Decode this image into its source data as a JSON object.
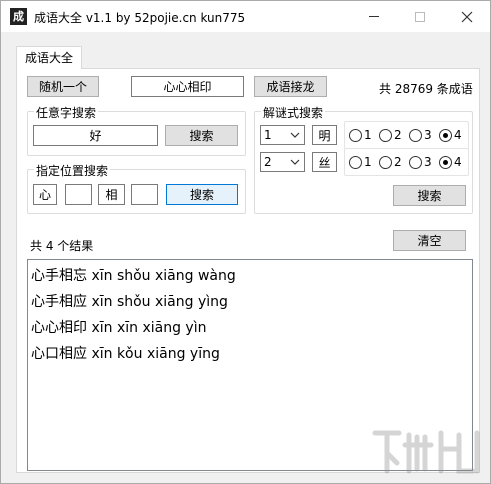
{
  "window": {
    "title": "成语大全 v1.1 by 52pojie.cn kun775",
    "icon_glyph": "成"
  },
  "tab": {
    "label": "成语大全"
  },
  "top": {
    "random_button": "随机一个",
    "current_idiom": "心心相印",
    "chain_button": "成语接龙",
    "total_text": "共 28769 条成语"
  },
  "any_search": {
    "title": "任意字搜索",
    "value": "好",
    "button": "搜索"
  },
  "position_search": {
    "title": "指定位置搜索",
    "chars": [
      "心",
      "",
      "相",
      ""
    ],
    "button": "搜索"
  },
  "riddle_search": {
    "title": "解谜式搜索",
    "rows": [
      {
        "select": "1",
        "char": "明",
        "options": [
          "1",
          "2",
          "3",
          "4"
        ],
        "selected": 3
      },
      {
        "select": "2",
        "char": "丝",
        "options": [
          "1",
          "2",
          "3",
          "4"
        ],
        "selected": 3
      }
    ],
    "button": "搜索"
  },
  "results": {
    "count_text": "共 4 个结果",
    "clear_button": "清空",
    "items": [
      "心手相忘 xīn shǒu xiāng wàng",
      "心手相应 xīn shǒu xiāng yìng",
      "心心相印 xīn xīn xiāng yìn",
      "心口相应 xīn kǒu xiāng yīng"
    ]
  },
  "icons": {
    "app": "app-icon",
    "minimize": "minimize-icon",
    "maximize": "maximize-icon",
    "close": "close-icon",
    "dropdown": "chevron-down-icon"
  }
}
